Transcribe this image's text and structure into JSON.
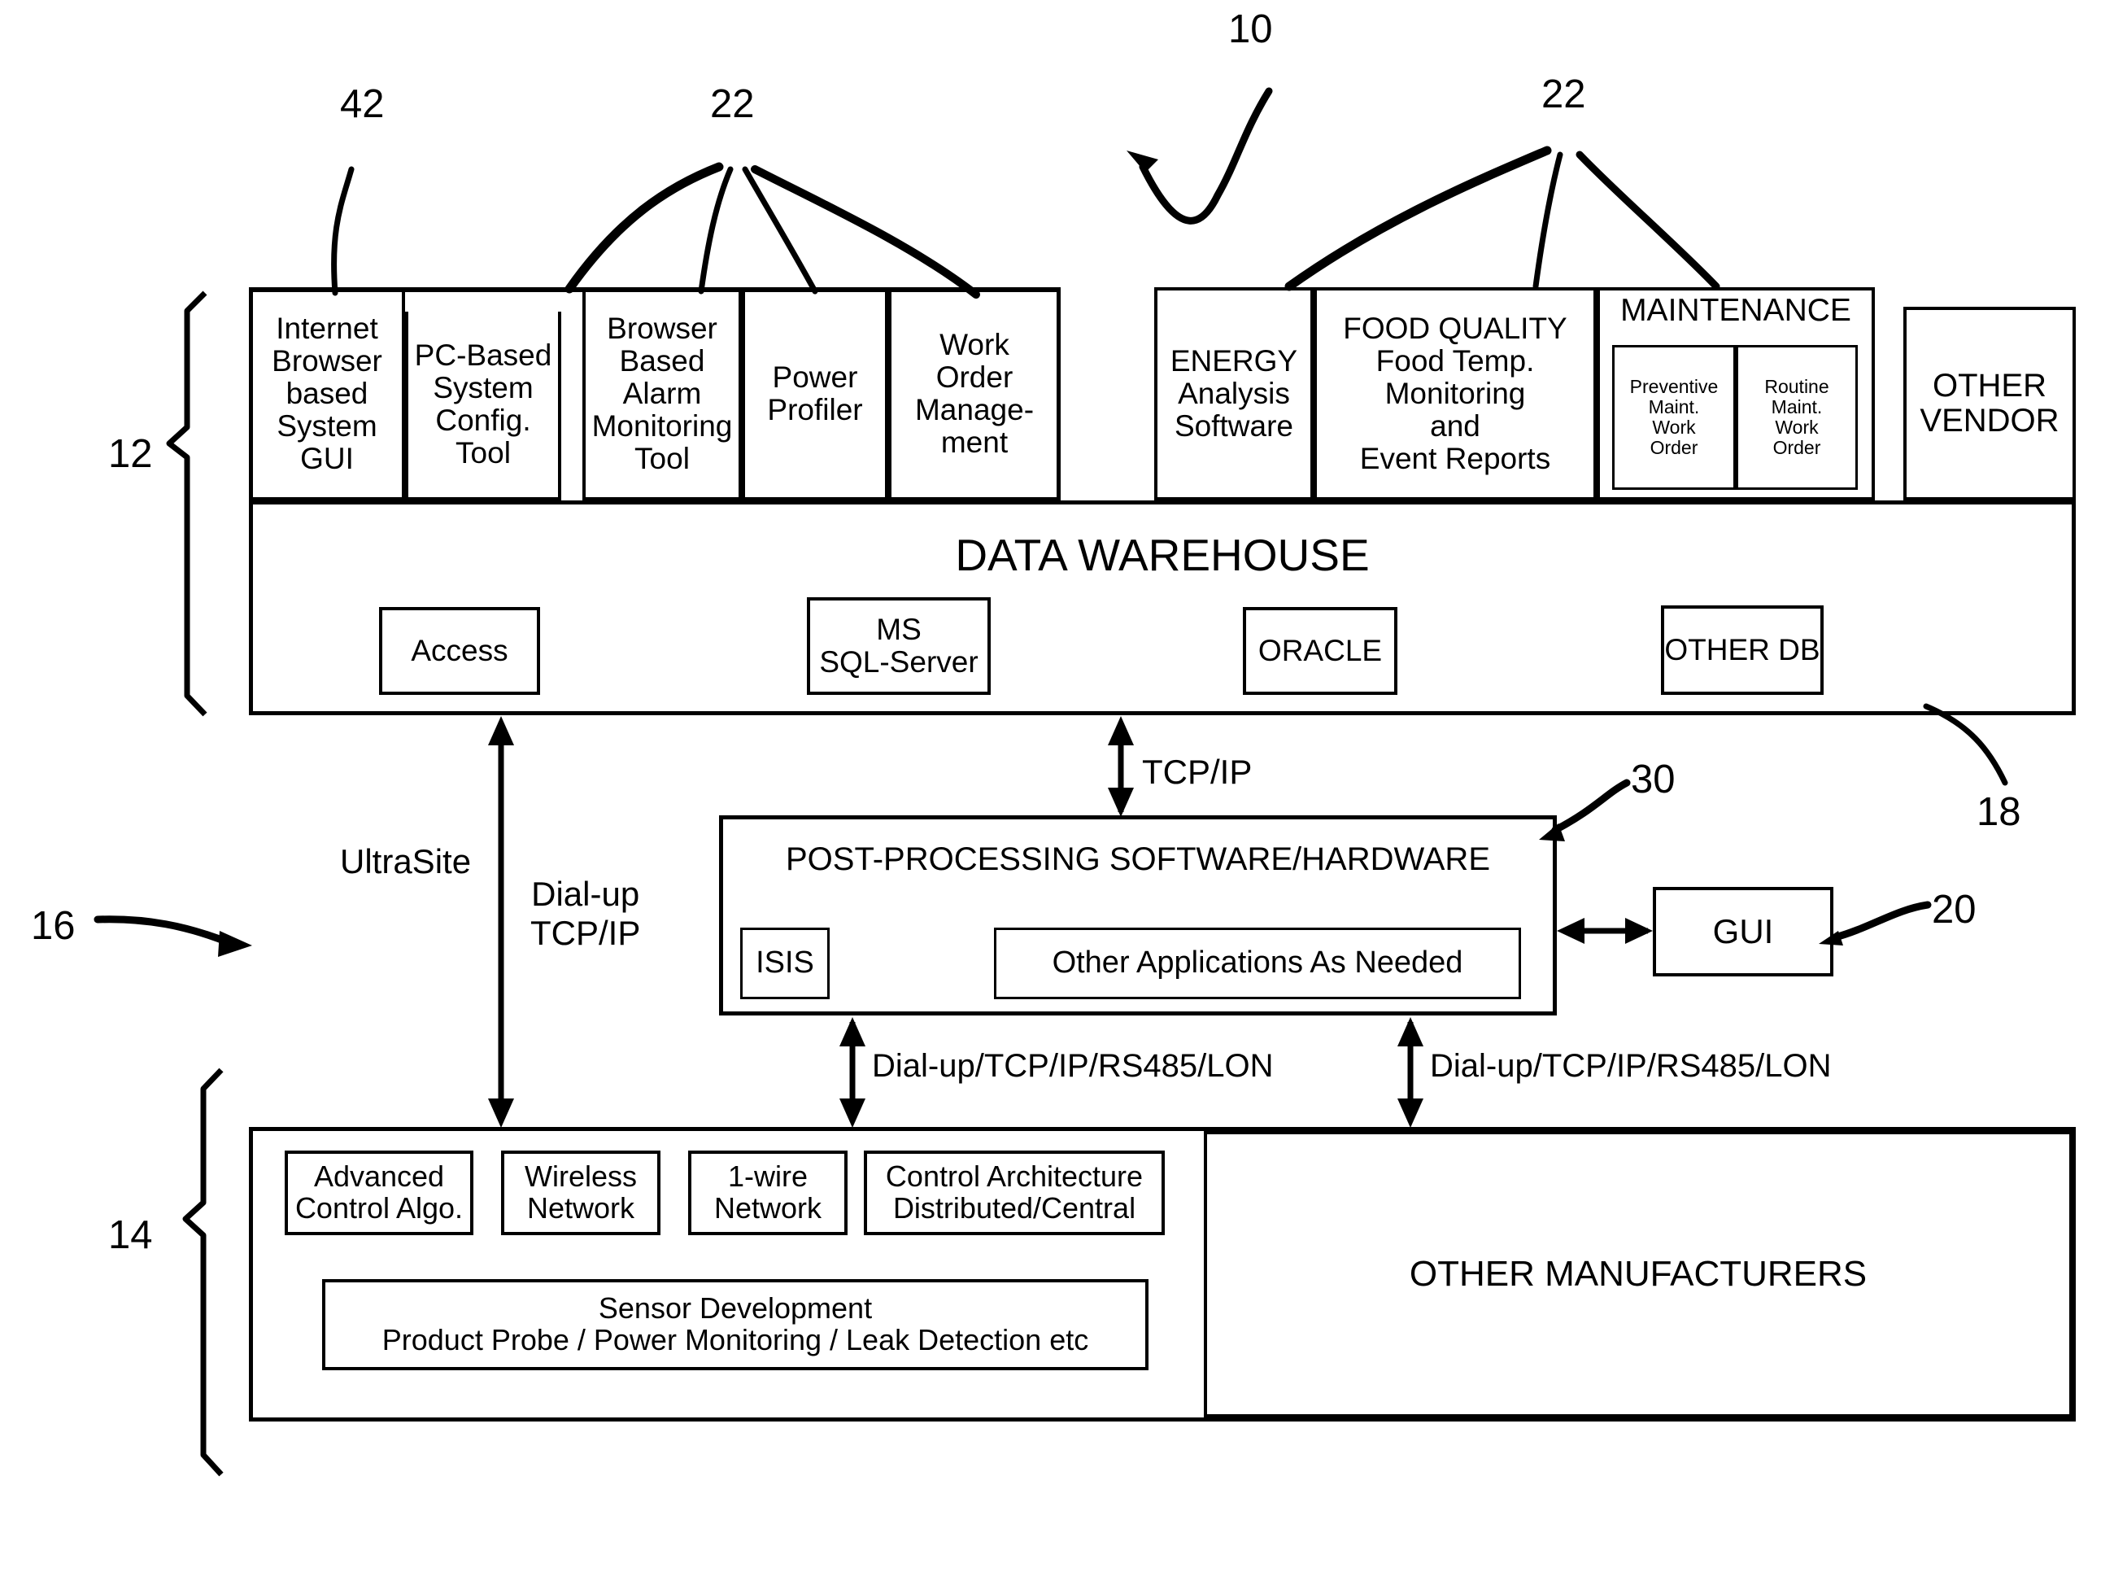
{
  "figure": {
    "ref_numbers": [
      {
        "id": "10",
        "label": "10"
      },
      {
        "id": "42",
        "label": "42"
      },
      {
        "id": "22a",
        "label": "22"
      },
      {
        "id": "22b",
        "label": "22"
      },
      {
        "id": "12",
        "label": "12"
      },
      {
        "id": "18",
        "label": "18"
      },
      {
        "id": "30",
        "label": "30"
      },
      {
        "id": "20",
        "label": "20"
      },
      {
        "id": "16",
        "label": "16"
      },
      {
        "id": "14",
        "label": "14"
      }
    ]
  },
  "application_layer": {
    "left_group": [
      {
        "lines": [
          "Internet",
          "Browser",
          "based",
          "System",
          "GUI"
        ]
      },
      {
        "lines": [
          "PC-Based",
          "System",
          "Config.",
          "Tool"
        ]
      },
      {
        "lines": [
          "Browser",
          "Based",
          "Alarm",
          "Monitoring",
          "Tool"
        ]
      },
      {
        "lines": [
          "Power",
          "Profiler"
        ]
      },
      {
        "lines": [
          "Work",
          "Order",
          "Manage-",
          "ment"
        ]
      }
    ],
    "right_group": [
      {
        "lines": [
          "ENERGY",
          "Analysis",
          "Software"
        ]
      },
      {
        "lines": [
          "FOOD QUALITY",
          "Food Temp.",
          "Monitoring",
          "and",
          "Event Reports"
        ]
      }
    ],
    "maintenance": {
      "title": "MAINTENANCE",
      "sub_boxes": [
        {
          "lines": [
            "Preventive",
            "Maint.",
            "Work",
            "Order"
          ]
        },
        {
          "lines": [
            "Routine",
            "Maint.",
            "Work",
            "Order"
          ]
        }
      ]
    },
    "other_vendor": {
      "lines": [
        "OTHER",
        "VENDOR"
      ]
    }
  },
  "data_warehouse": {
    "title": "DATA WAREHOUSE",
    "databases": [
      {
        "lines": [
          "Access"
        ]
      },
      {
        "lines": [
          "MS",
          "SQL-Server"
        ]
      },
      {
        "lines": [
          "ORACLE"
        ]
      },
      {
        "lines": [
          "OTHER DB"
        ]
      }
    ]
  },
  "post_processing": {
    "title": "POST-PROCESSING SOFTWARE/HARDWARE",
    "isis": "ISIS",
    "other_apps": "Other Applications As Needed",
    "gui": "GUI"
  },
  "connectors": {
    "tcpip": "TCP/IP",
    "ultrasite": "UltraSite",
    "dialup_tcpip": [
      "Dial-up",
      "TCP/IP"
    ],
    "bus_left": "Dial-up/TCP/IP/RS485/LON",
    "bus_right": "Dial-up/TCP/IP/RS485/LON"
  },
  "field_layer": {
    "boxes": [
      {
        "lines": [
          "Advanced",
          "Control Algo."
        ]
      },
      {
        "lines": [
          "Wireless",
          "Network"
        ]
      },
      {
        "lines": [
          "1-wire",
          "Network"
        ]
      },
      {
        "lines": [
          "Control Architecture",
          "Distributed/Central"
        ]
      }
    ],
    "sensor": {
      "lines": [
        "Sensor Development",
        "Product Probe / Power Monitoring / Leak Detection etc"
      ]
    },
    "other_manufacturers": "OTHER MANUFACTURERS"
  },
  "colors": {
    "ink": "#000000",
    "paper": "#ffffff"
  }
}
